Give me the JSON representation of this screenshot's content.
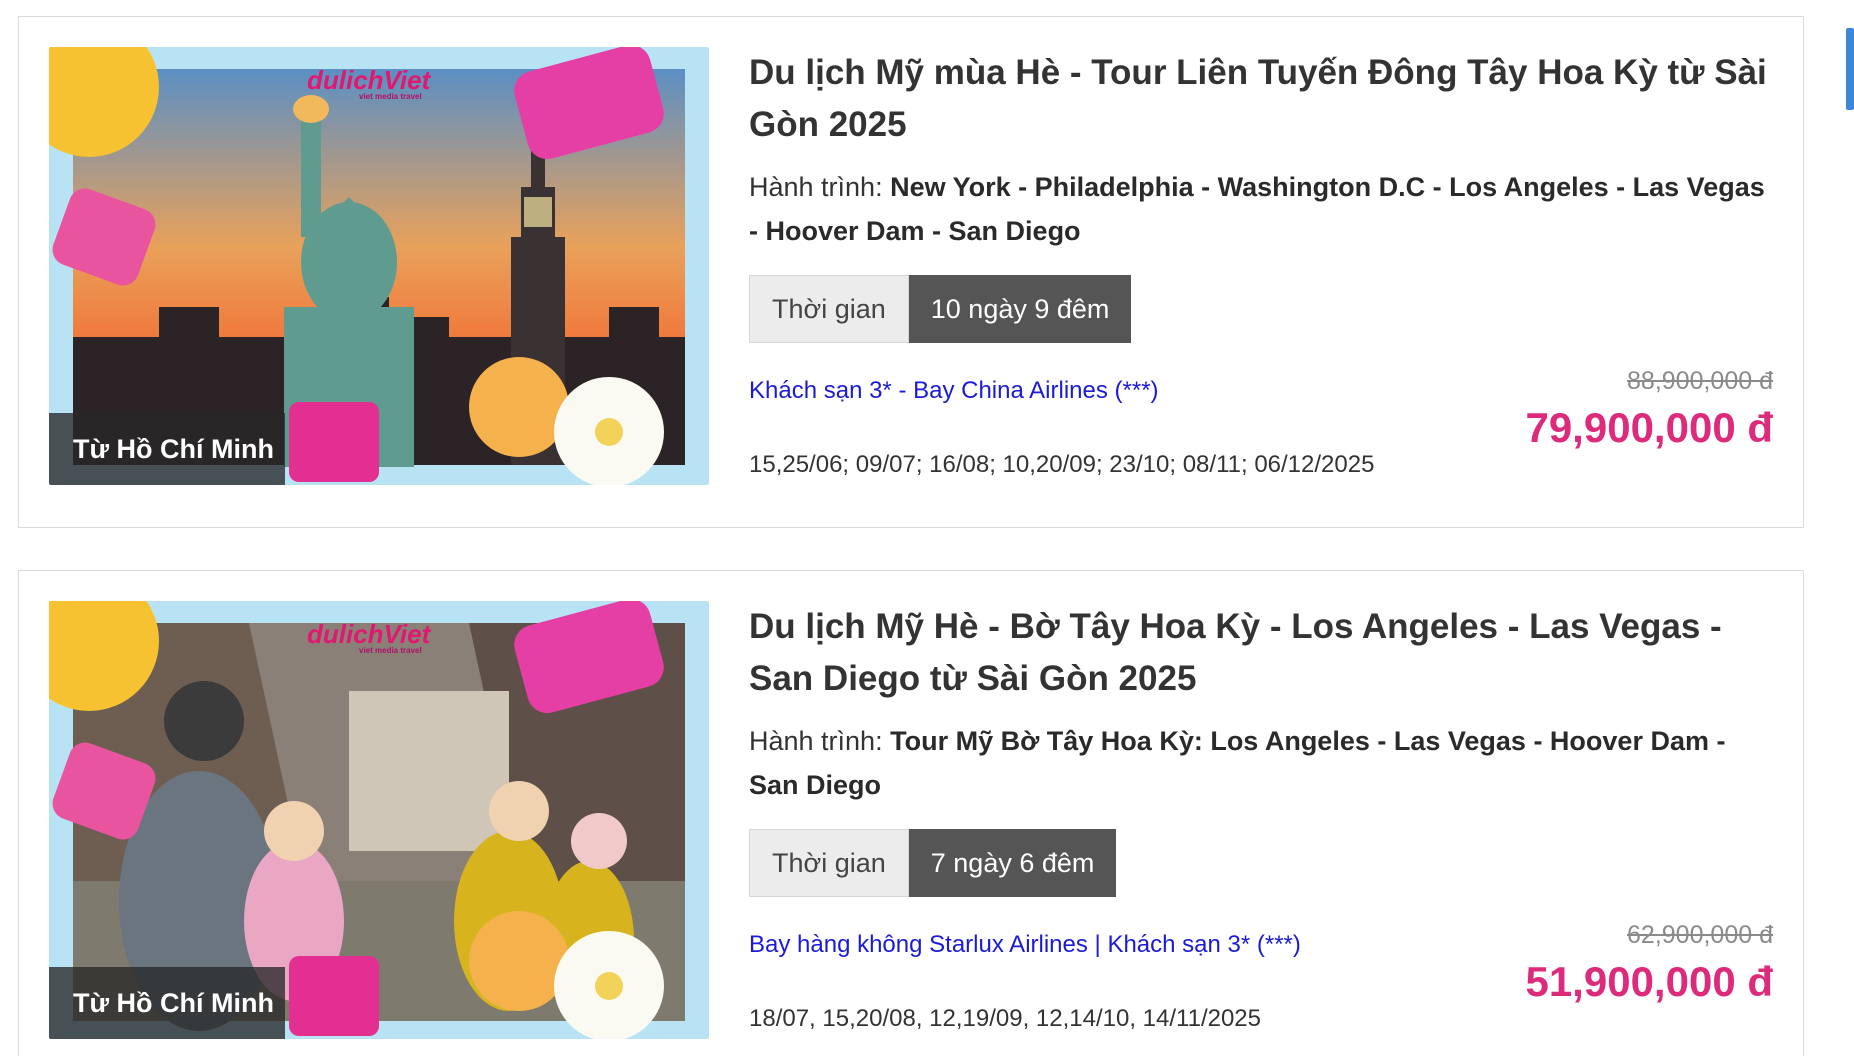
{
  "tours": [
    {
      "title": "Du lịch Mỹ mùa Hè - Tour Liên Tuyến Đông Tây Hoa Kỳ từ Sài Gòn 2025",
      "route_label": "Hành trình:",
      "route": "New York - Philadelphia - Washington D.C - Los Angeles - Las Vegas - Hoover Dam - San Diego",
      "duration_label": "Thời gian",
      "duration": "10 ngày 9 đêm",
      "hotel_flight": "Khách sạn 3* - Bay China Airlines (***)",
      "dates": "15,25/06; 09/07; 16/08; 10,20/09; 23/10; 08/11; 06/12/2025",
      "old_price": "88,900,000 đ",
      "price": "79,900,000 đ",
      "origin": "Từ Hồ Chí Minh",
      "brand": "dulichViet",
      "brand_sub": "viet media travel"
    },
    {
      "title": "Du lịch Mỹ Hè - Bờ Tây Hoa Kỳ - Los Angeles - Las Vegas - San Diego từ Sài Gòn 2025",
      "route_label": "Hành trình:",
      "route": "Tour Mỹ Bờ Tây Hoa Kỳ: Los Angeles - Las Vegas - Hoover Dam - San Diego",
      "duration_label": "Thời gian",
      "duration": "7 ngày 6 đêm",
      "hotel_flight": "Bay hàng không Starlux Airlines | Khách sạn 3* (***)",
      "dates": "18/07, 15,20/08, 12,19/09, 12,14/10, 14/11/2025",
      "old_price": "62,900,000 đ",
      "price": "51,900,000 đ",
      "origin": "Từ Hồ Chí Minh",
      "brand": "dulichViet",
      "brand_sub": "viet media travel"
    }
  ],
  "colors": {
    "price": "#dd2a7b",
    "link": "#1a1ad8",
    "duration_bg": "#555555",
    "accent_scroll": "#3b86d8"
  }
}
